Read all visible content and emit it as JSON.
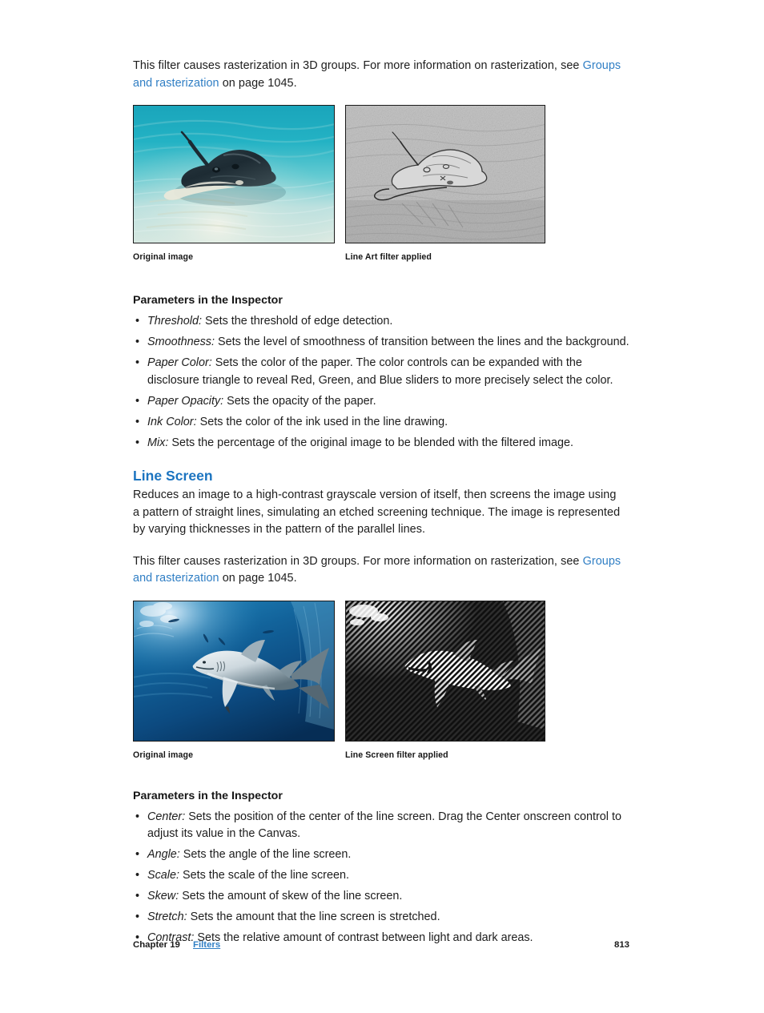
{
  "page": {
    "number": "813",
    "footer_chapter": "Chapter 19",
    "footer_chapter_link": "Filters"
  },
  "intro_paragraph_1": {
    "text_before_link": "This filter causes rasterization in 3D groups. For more information on rasterization, see ",
    "link_text": "Groups and rasterization",
    "text_after_link": " on page 1045."
  },
  "figure_group_1": {
    "left_caption": "Original image",
    "right_caption": "Line Art filter applied",
    "left_alt": "underwater-stingray-photo",
    "right_alt": "stingray-line-art-filtered"
  },
  "line_art_section": {
    "params_heading": "Parameters in the Inspector",
    "params": [
      {
        "term": "Threshold:",
        "desc": " Sets the threshold of edge detection."
      },
      {
        "term": "Smoothness:",
        "desc": " Sets the level of smoothness of transition between the lines and the background."
      },
      {
        "term": "Paper Color:",
        "desc": " Sets the color of the paper. The color controls can be expanded with the disclosure triangle to reveal Red, Green, and Blue sliders to more precisely select the color."
      },
      {
        "term": "Paper Opacity:",
        "desc": " Sets the opacity of the paper."
      },
      {
        "term": "Ink Color:",
        "desc": " Sets the color of the ink used in the line drawing."
      },
      {
        "term": "Mix:",
        "desc": " Sets the percentage of the original image to be blended with the filtered image."
      }
    ]
  },
  "line_screen_section": {
    "heading": "Line Screen",
    "description": "Reduces an image to a high-contrast grayscale version of itself, then screens the image using a pattern of straight lines, simulating an etched screening technique. The image is represented by varying thicknesses in the pattern of the parallel lines.",
    "rasterization_note": {
      "text_before_link": "This filter causes rasterization in 3D groups. For more information on rasterization, see ",
      "link_text": "Groups and rasterization",
      "text_after_link": " on page 1045."
    },
    "params_heading": "Parameters in the Inspector",
    "params": [
      {
        "term": "Center:",
        "desc": " Sets the position of the center of the line screen. Drag the Center onscreen control to adjust its value in the Canvas."
      },
      {
        "term": "Angle:",
        "desc": " Sets the angle of the line screen."
      },
      {
        "term": "Scale:",
        "desc": " Sets the scale of the line screen."
      },
      {
        "term": "Skew:",
        "desc": " Sets the amount of skew of the line screen."
      },
      {
        "term": "Stretch:",
        "desc": " Sets the amount that the line screen is stretched."
      },
      {
        "term": "Contrast:",
        "desc": " Sets the relative amount of contrast between light and dark areas."
      }
    ]
  },
  "figure_group_2": {
    "left_caption": "Original image",
    "right_caption": "Line Screen filter applied",
    "left_alt": "underwater-shark-photo",
    "right_alt": "shark-line-screen-filtered"
  },
  "colors": {
    "link": "#2f7ec4",
    "heading": "#1c74c0",
    "body_text": "#1d1d1d",
    "figure_border": "#1a1a1a"
  }
}
